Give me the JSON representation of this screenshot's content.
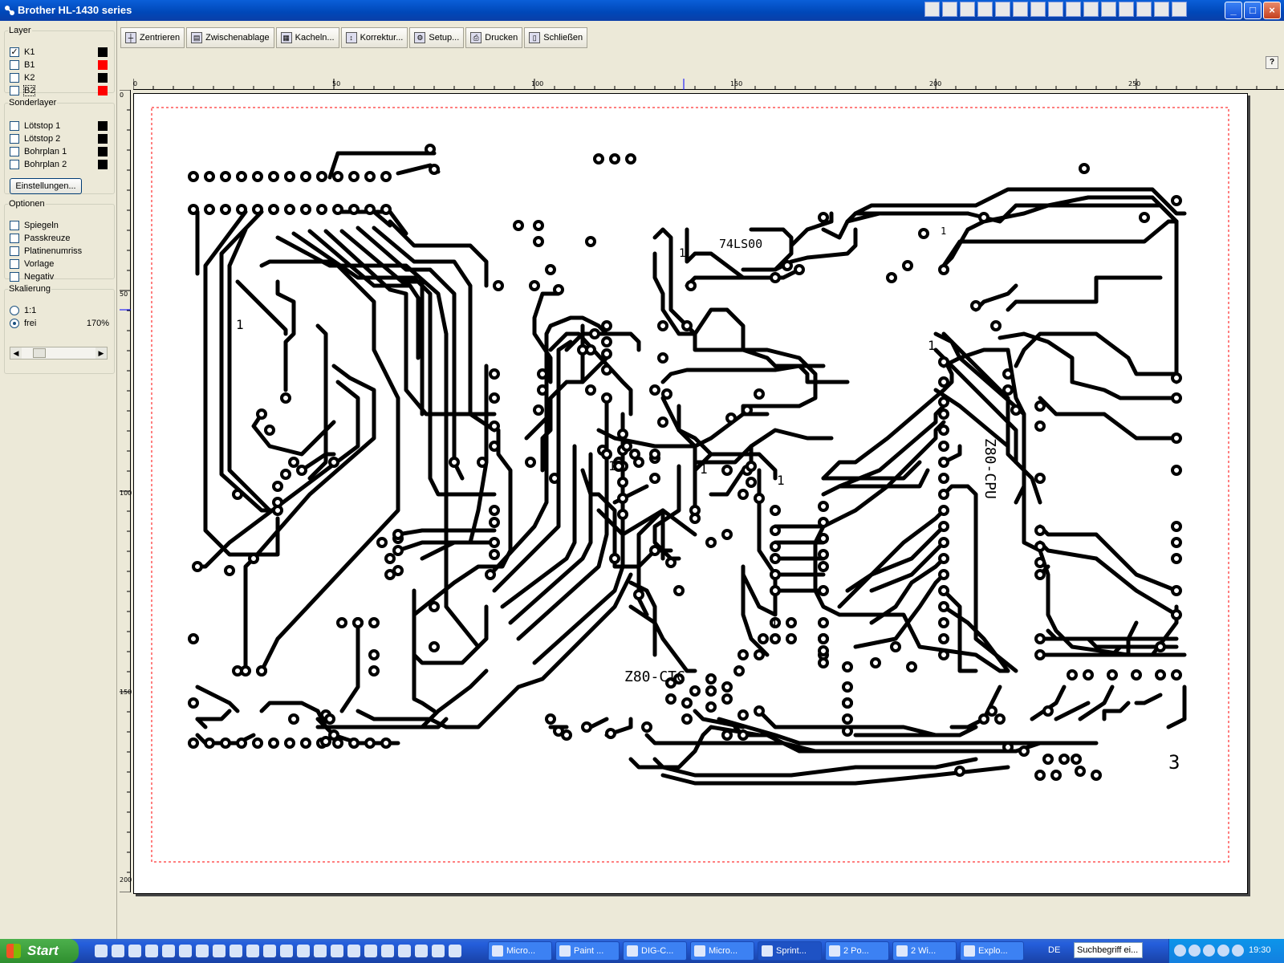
{
  "window": {
    "title": "Brother HL-1430 series",
    "controls": {
      "minimize": "_",
      "maximize": "□",
      "close": "×"
    }
  },
  "left_panel": {
    "layer": {
      "legend": "Layer",
      "items": [
        {
          "label": "K1",
          "checked": true,
          "color": "#000000"
        },
        {
          "label": "B1",
          "checked": false,
          "color": "#ff0000"
        },
        {
          "label": "K2",
          "checked": false,
          "color": "#000000"
        },
        {
          "label": "B2",
          "checked": false,
          "color": "#ff0000"
        }
      ]
    },
    "sonderlayer": {
      "legend": "Sonderlayer",
      "items": [
        {
          "label": "Lötstop 1",
          "checked": false,
          "color": "#000000"
        },
        {
          "label": "Lötstop 2",
          "checked": false,
          "color": "#000000"
        },
        {
          "label": "Bohrplan 1",
          "checked": false,
          "color": "#000000"
        },
        {
          "label": "Bohrplan 2",
          "checked": false,
          "color": "#000000"
        }
      ],
      "settings_button": "Einstellungen..."
    },
    "optionen": {
      "legend": "Optionen",
      "items": [
        "Spiegeln",
        "Passkreuze",
        "Platinenumriss",
        "Vorlage",
        "Negativ"
      ]
    },
    "skalierung": {
      "legend": "Skalierung",
      "option_1": "1:1",
      "option_2": "frei",
      "selected": "frei",
      "value": "170%"
    }
  },
  "toolbar": {
    "buttons": [
      {
        "label": "Zentrieren",
        "icon": "center-icon"
      },
      {
        "label": "Zwischenablage",
        "icon": "clipboard-icon"
      },
      {
        "label": "Kacheln...",
        "icon": "tiles-icon"
      },
      {
        "label": "Korrektur...",
        "icon": "correction-icon"
      },
      {
        "label": "Setup...",
        "icon": "setup-icon"
      },
      {
        "label": "Drucken",
        "icon": "printer-icon"
      },
      {
        "label": "Schließen",
        "icon": "close-door-icon"
      }
    ],
    "help": "?"
  },
  "rulers": {
    "top_labels": [
      "0",
      "50",
      "100",
      "150",
      "200",
      "250"
    ],
    "left_labels": [
      "0",
      "50",
      "100",
      "150",
      "200"
    ]
  },
  "pcb": {
    "labels": {
      "ic1": "74LS00",
      "ic2": "Z80-CPU",
      "ic3": "Z80-CTC",
      "board_number": "3",
      "pin1": "1"
    },
    "trace_color": "#000000",
    "outline_color": "#ff0000"
  },
  "taskbar": {
    "start": "Start",
    "tasks": [
      "Micro...",
      "Paint ...",
      "DIG-C...",
      "Micro...",
      "Sprint...",
      "2 Po...",
      "2 Wi...",
      "Explo..."
    ],
    "language": "DE",
    "search_placeholder": "Suchbegriff ei...",
    "clock": "19:30"
  }
}
